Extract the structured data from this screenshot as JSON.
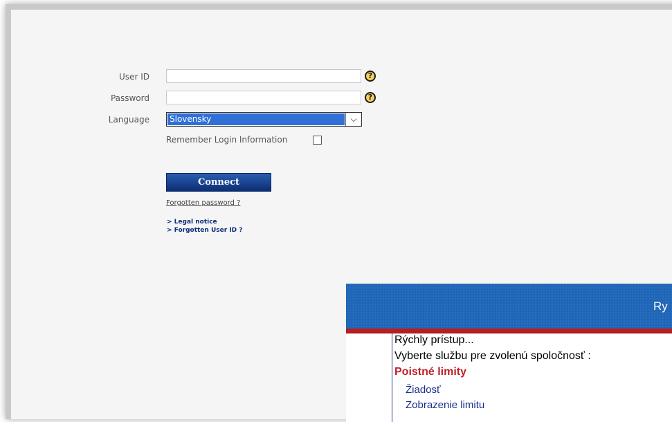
{
  "login": {
    "user_id_label": "User ID",
    "password_label": "Password",
    "language_label": "Language",
    "language_selected": "Slovensky",
    "remember_label": "Remember Login Information",
    "connect_label": "Connect",
    "forgot_password_link": "Forgotten password ?",
    "legal_notice_link": "> Legal notice",
    "forgot_userid_link": "> Forgotten User ID ?",
    "help_icon_glyph": "?"
  },
  "panel": {
    "header_title": "Ry",
    "quick_access": "Rýchly prístup...",
    "select_service": "Vyberte službu pre zvolenú spoločnosť :",
    "section_title": "Poistné limity",
    "item_request": "Žiadosť",
    "item_partial": "Zobrazenie limitu"
  },
  "colors": {
    "button_blue": "#1a3f8f",
    "select_highlight": "#2f6fd6",
    "panel_header": "#1f66b8",
    "panel_red": "#c0202a"
  }
}
